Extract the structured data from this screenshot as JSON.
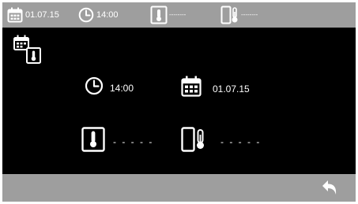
{
  "status_bar": {
    "date": "01.07.15",
    "time": "14:00",
    "indoor_temp": "--------",
    "outdoor_temp": "--------",
    "icons": [
      "calendar-icon",
      "clock-icon",
      "thermometer-icon",
      "outdoor-thermometer-icon"
    ]
  },
  "main": {
    "page_icon": "calendar-thermometer-icon",
    "time_value": "14:00",
    "date_value": "01.07.15",
    "indoor_temp_value": "- - - - -",
    "outdoor_temp_value": "- - - - -"
  },
  "bottom_bar": {
    "back_icon": "back-arrow-icon"
  },
  "colors": {
    "bar_gray": "#9e9e9e",
    "background": "#000000",
    "foreground": "#ffffff"
  }
}
